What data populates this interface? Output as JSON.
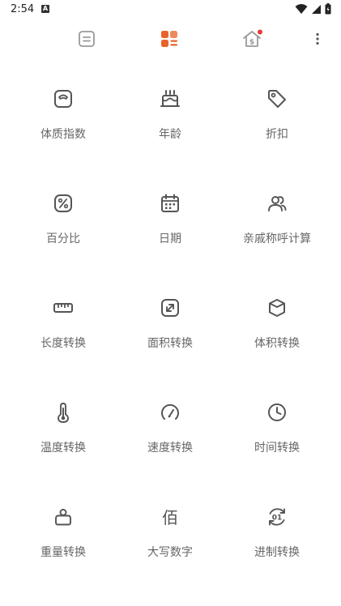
{
  "status": {
    "time": "2:54",
    "notif_icon": "A"
  },
  "toolbar": {
    "tabs": [
      {
        "name": "history-icon"
      },
      {
        "name": "tools-grid-icon",
        "active": true
      },
      {
        "name": "exchange-rate-icon",
        "badge": true
      },
      {
        "name": "more-vert-icon"
      }
    ]
  },
  "colors": {
    "accent": "#E8622A",
    "icon": "#555555",
    "badge": "#E53935"
  },
  "tools": [
    {
      "label": "体质指数",
      "icon": "scale-icon"
    },
    {
      "label": "年龄",
      "icon": "cake-icon"
    },
    {
      "label": "折扣",
      "icon": "tag-icon"
    },
    {
      "label": "百分比",
      "icon": "percent-icon"
    },
    {
      "label": "日期",
      "icon": "calendar-icon"
    },
    {
      "label": "亲戚称呼计算",
      "icon": "relatives-icon"
    },
    {
      "label": "长度转换",
      "icon": "ruler-icon"
    },
    {
      "label": "面积转换",
      "icon": "area-icon"
    },
    {
      "label": "体积转换",
      "icon": "volume-icon"
    },
    {
      "label": "温度转换",
      "icon": "thermometer-icon"
    },
    {
      "label": "速度转换",
      "icon": "speedometer-icon"
    },
    {
      "label": "时间转换",
      "icon": "clock-icon"
    },
    {
      "label": "重量转换",
      "icon": "weight-icon"
    },
    {
      "label": "大写数字",
      "icon": "chinese-numeral-icon",
      "glyph": "佰"
    },
    {
      "label": "进制转换",
      "icon": "base-convert-icon",
      "glyph": "01"
    }
  ]
}
